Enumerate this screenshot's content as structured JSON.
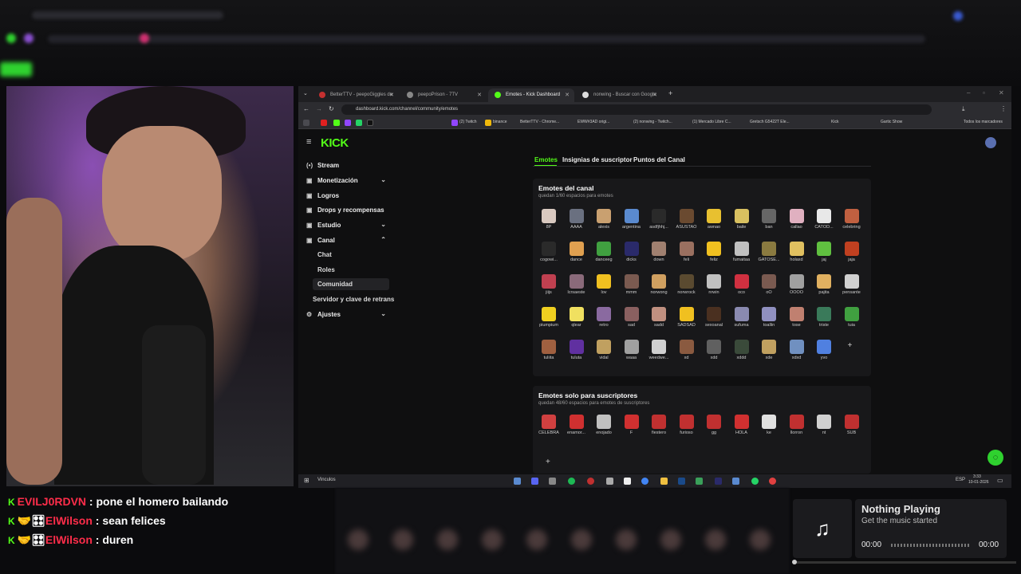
{
  "browser": {
    "tabs": [
      {
        "label": "BetterTTV - peepoGiggles de",
        "fav": "#c43030",
        "active": false
      },
      {
        "label": "peepoPrison - 7TV",
        "fav": "#888",
        "active": false
      },
      {
        "label": "Emotes - Kick Dashboard",
        "fav": "#53fc18",
        "active": true
      },
      {
        "label": "nonwing - Buscar con Google",
        "fav": "#ddd",
        "active": false
      }
    ],
    "url": "dashboard.kick.com/channel/community/emotes",
    "bookmarks": [
      "(2) Twitch",
      "binance",
      "BetterTTV - Chrome...",
      "EWW#3AD origi...",
      "(2) nonwing - Twitch...",
      "(1) Mercado Libre C...",
      "Gretsch G5422T Ele...",
      "Kick",
      "Gartic Show",
      "Todos los marcadores"
    ]
  },
  "sidebar": {
    "logo": "KICK",
    "items": [
      {
        "label": "Stream",
        "icon": "(•)",
        "chev": ""
      },
      {
        "label": "Monetización",
        "icon": "▬",
        "chev": "⌄"
      },
      {
        "label": "Logros",
        "icon": "▬",
        "chev": ""
      },
      {
        "label": "Drops y recompensas",
        "icon": "▬",
        "chev": ""
      },
      {
        "label": "Estudio",
        "icon": "▬",
        "chev": "⌄"
      },
      {
        "label": "Canal",
        "icon": "▬",
        "chev": "⌃"
      }
    ],
    "subitems": [
      "Chat",
      "Roles",
      "Comunidad"
    ],
    "server": "Servidor y clave de retrans",
    "settings": "Ajustes"
  },
  "tabs": [
    "Emotes",
    "Insignias de suscriptor",
    "Puntos del Canal"
  ],
  "channel_emotes": {
    "title": "Emotes del canal",
    "subtitle": "quedan 1/60 espacios para emotes",
    "labels": [
      "8P",
      "AAAA",
      "alexis",
      "argentina",
      "asdfjhhj...",
      "ASUSTAO",
      "awnao",
      "baile",
      "ban",
      "callao",
      "CATOD...",
      "celebring",
      "cogowi...",
      "dance",
      "danceeg",
      "dicks",
      "down",
      "feli",
      "feliz",
      "fumaitaa",
      "GATOSE...",
      "holaxd",
      "jaj",
      "jaja",
      "jiijs",
      "lcrsaeste",
      "lov",
      "mmm",
      "norwong",
      "norwrock",
      "nrwin",
      "oco",
      "oO",
      "OOOO",
      "pajita",
      "pensante",
      "piumpium",
      "qlear",
      "retro",
      "sad",
      "sadd",
      "SADSAD",
      "sexoanal",
      "sufuma",
      "toallin",
      "tose",
      "triste",
      "tuia",
      "tuliita",
      "tuluta",
      "vidal",
      "waaa",
      "weedwe...",
      "xd",
      "xdd",
      "xddd",
      "xde",
      "xdxd",
      "yvo"
    ],
    "colors": [
      "#d9c9c0",
      "#6a7080",
      "#c9a070",
      "#5a8acf",
      "#2a2a2a",
      "#6a4a30",
      "#e8c030",
      "#d8c060",
      "#666",
      "#e0b0c0",
      "#e8e8e8",
      "#c06040",
      "#2a2a2a",
      "#e0a050",
      "#40a040",
      "#2a2a6a",
      "#a08070",
      "#9a7060",
      "#f0c020",
      "#c0c0c0",
      "#8a7a40",
      "#e0c060",
      "#60c040",
      "#c04020",
      "#c04050",
      "#8a6a7a",
      "#f0c020",
      "#7a5a50",
      "#d0a060",
      "#5a4a30",
      "#c0c0c0",
      "#d03040",
      "#7a5a50",
      "#a0a0a0",
      "#e0b060",
      "#d0d0d0",
      "#f0d020",
      "#f0e060",
      "#8a6aa0",
      "#8a6060",
      "#c09080",
      "#f0c020",
      "#4a3020",
      "#8a8ab0",
      "#9090c0",
      "#c08070",
      "#3a7a5a",
      "#40a040",
      "#a06040",
      "#6030a0",
      "#c0a060",
      "#a0a0a0",
      "#d0d0d0",
      "#8a5a40",
      "#606060",
      "#3a4a3a",
      "#c0a060",
      "#7090c0",
      "#5080e0"
    ]
  },
  "sub_emotes": {
    "title": "Emotes solo para suscriptores",
    "subtitle": "quedan 48/60 espacios para emotes de suscriptores",
    "labels": [
      "CELEBRA",
      "enamor...",
      "enojado",
      "F",
      "fiestero",
      "furioso",
      "gg",
      "HOLA",
      "ke",
      "llorron",
      "nt",
      "SUB"
    ],
    "colors": [
      "#d04040",
      "#d03030",
      "#c0c0c0",
      "#d03030",
      "#c03030",
      "#c03030",
      "#c03030",
      "#d03030",
      "#e0e0e0",
      "#c03030",
      "#d0d0d0",
      "#c03030"
    ]
  },
  "taskbar": {
    "search": "Vinculos",
    "lang": "ESP",
    "time": "3:33",
    "date": "10-01-2026"
  },
  "chat": [
    {
      "user": "EVILJ0RDVN",
      "msg": ": pone el homero bailando",
      "badges": ""
    },
    {
      "user": "ElWilson",
      "msg": ": sean felices",
      "badges": "🤝🎛"
    },
    {
      "user": "ElWilson",
      "msg": ": duren",
      "badges": "🤝🎛"
    }
  ],
  "music": {
    "title": "Nothing Playing",
    "subtitle": "Get the music started",
    "elapsed": "00:00",
    "total": "00:00",
    "icon": "music-note-icon"
  }
}
